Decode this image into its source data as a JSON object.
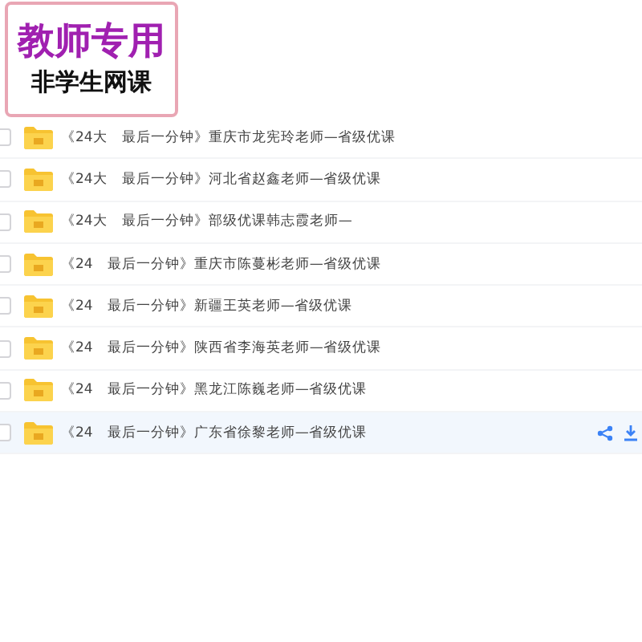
{
  "badge": {
    "title": "教师专用",
    "subtitle": "非学生网课"
  },
  "files": [
    {
      "name": "《24大　最后一分钟》重庆市龙宪玲老师—省级优课",
      "checked": false,
      "selected": false
    },
    {
      "name": "《24大　最后一分钟》河北省赵鑫老师—省级优课",
      "checked": false,
      "selected": false
    },
    {
      "name": "《24大　最后一分钟》部级优课韩志霞老师—",
      "checked": false,
      "selected": false
    },
    {
      "name": "《24　最后一分钟》重庆市陈蔓彬老师—省级优课",
      "checked": false,
      "selected": false
    },
    {
      "name": "《24　最后一分钟》新疆王英老师—省级优课",
      "checked": false,
      "selected": false
    },
    {
      "name": "《24　最后一分钟》陕西省李海英老师—省级优课",
      "checked": false,
      "selected": false
    },
    {
      "name": "《24　最后一分钟》黑龙江陈巍老师—省级优课",
      "checked": false,
      "selected": false
    },
    {
      "name": "《24　最后一分钟》广东省徐黎老师—省级优课",
      "checked": false,
      "selected": true
    }
  ]
}
